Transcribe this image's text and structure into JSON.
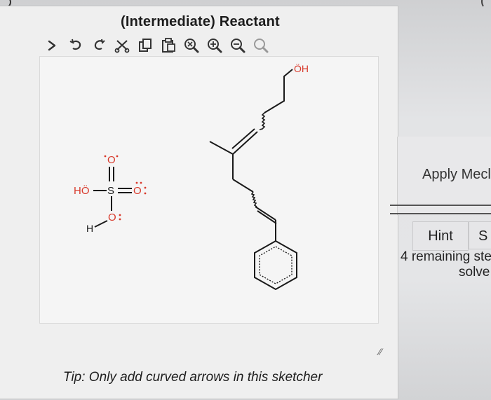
{
  "panel": {
    "title": "(Intermediate) Reactant",
    "tip": "Tip: Only add curved arrows in this sketcher"
  },
  "toolbar": {
    "tools": [
      {
        "icon": "chevron-right-icon"
      },
      {
        "icon": "undo-icon"
      },
      {
        "icon": "redo-icon"
      },
      {
        "icon": "cut-icon"
      },
      {
        "icon": "copy-icon"
      },
      {
        "icon": "paste-icon"
      },
      {
        "icon": "zoom-reset-icon"
      },
      {
        "icon": "zoom-in-icon"
      },
      {
        "icon": "zoom-out-icon"
      },
      {
        "icon": "zoom-fit-icon"
      }
    ]
  },
  "molecules": {
    "sulfuric_acid": {
      "ho": "HÖ",
      "s": "S",
      "o_top": "O",
      "o_right": "O",
      "o_bottom": "O",
      "h": "H"
    },
    "alcohol": {
      "oh": "ÖH"
    }
  },
  "sidebar": {
    "apply_label": "Apply Mecl",
    "hint_label": "Hint",
    "s_label": "S",
    "remaining_line1": "4 remaining ste",
    "remaining_line2": "solve"
  },
  "colors": {
    "oxygen": "#d8392b",
    "bond": "#1a1a1a",
    "panel_bg": "#efefef"
  }
}
